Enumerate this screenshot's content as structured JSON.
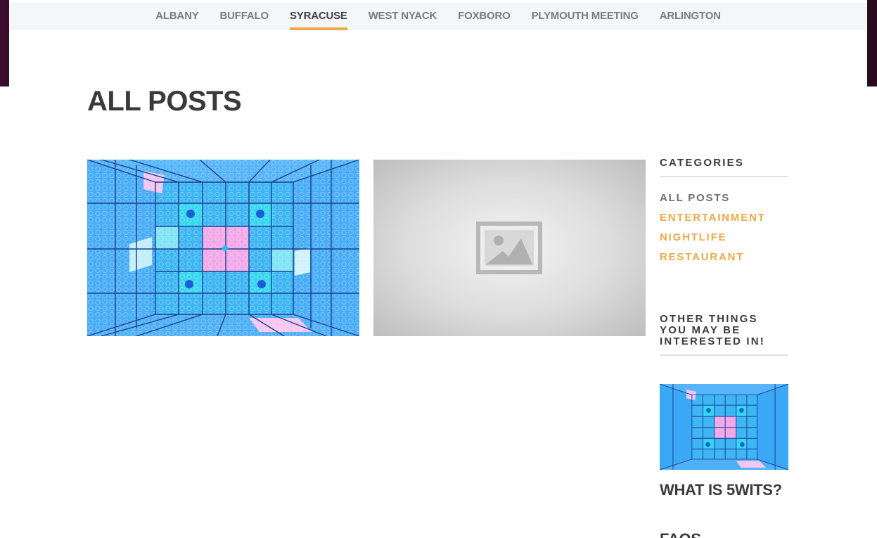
{
  "nav": {
    "items": [
      "ALBANY",
      "BUFFALO",
      "SYRACUSE",
      "WEST NYACK",
      "FOXBORO",
      "PLYMOUTH MEETING",
      "ARLINGTON"
    ],
    "active": "SYRACUSE"
  },
  "page_title": "ALL POSTS",
  "posts": [
    {
      "image": "glowing-grid-room-image"
    },
    {
      "image": "image-placeholder-icon"
    }
  ],
  "sidebar": {
    "categories_heading": "CATEGORIES",
    "categories": [
      "ALL POSTS",
      "ENTERTAINMENT",
      "NIGHTLIFE",
      "RESTAURANT"
    ],
    "related_heading": "OTHER THINGS YOU MAY BE INTERESTED IN!",
    "related": [
      {
        "title": "WHAT IS 5WITS?"
      },
      {
        "title": "FAQS"
      }
    ]
  },
  "colors": {
    "accent": "#f0a847",
    "text": "#3a3a3a",
    "nav_bg": "#f4f6f7",
    "grid_blue": "#3aa8f5",
    "grid_pink": "#f2a9e8",
    "grid_cyan": "#38e0f2"
  }
}
